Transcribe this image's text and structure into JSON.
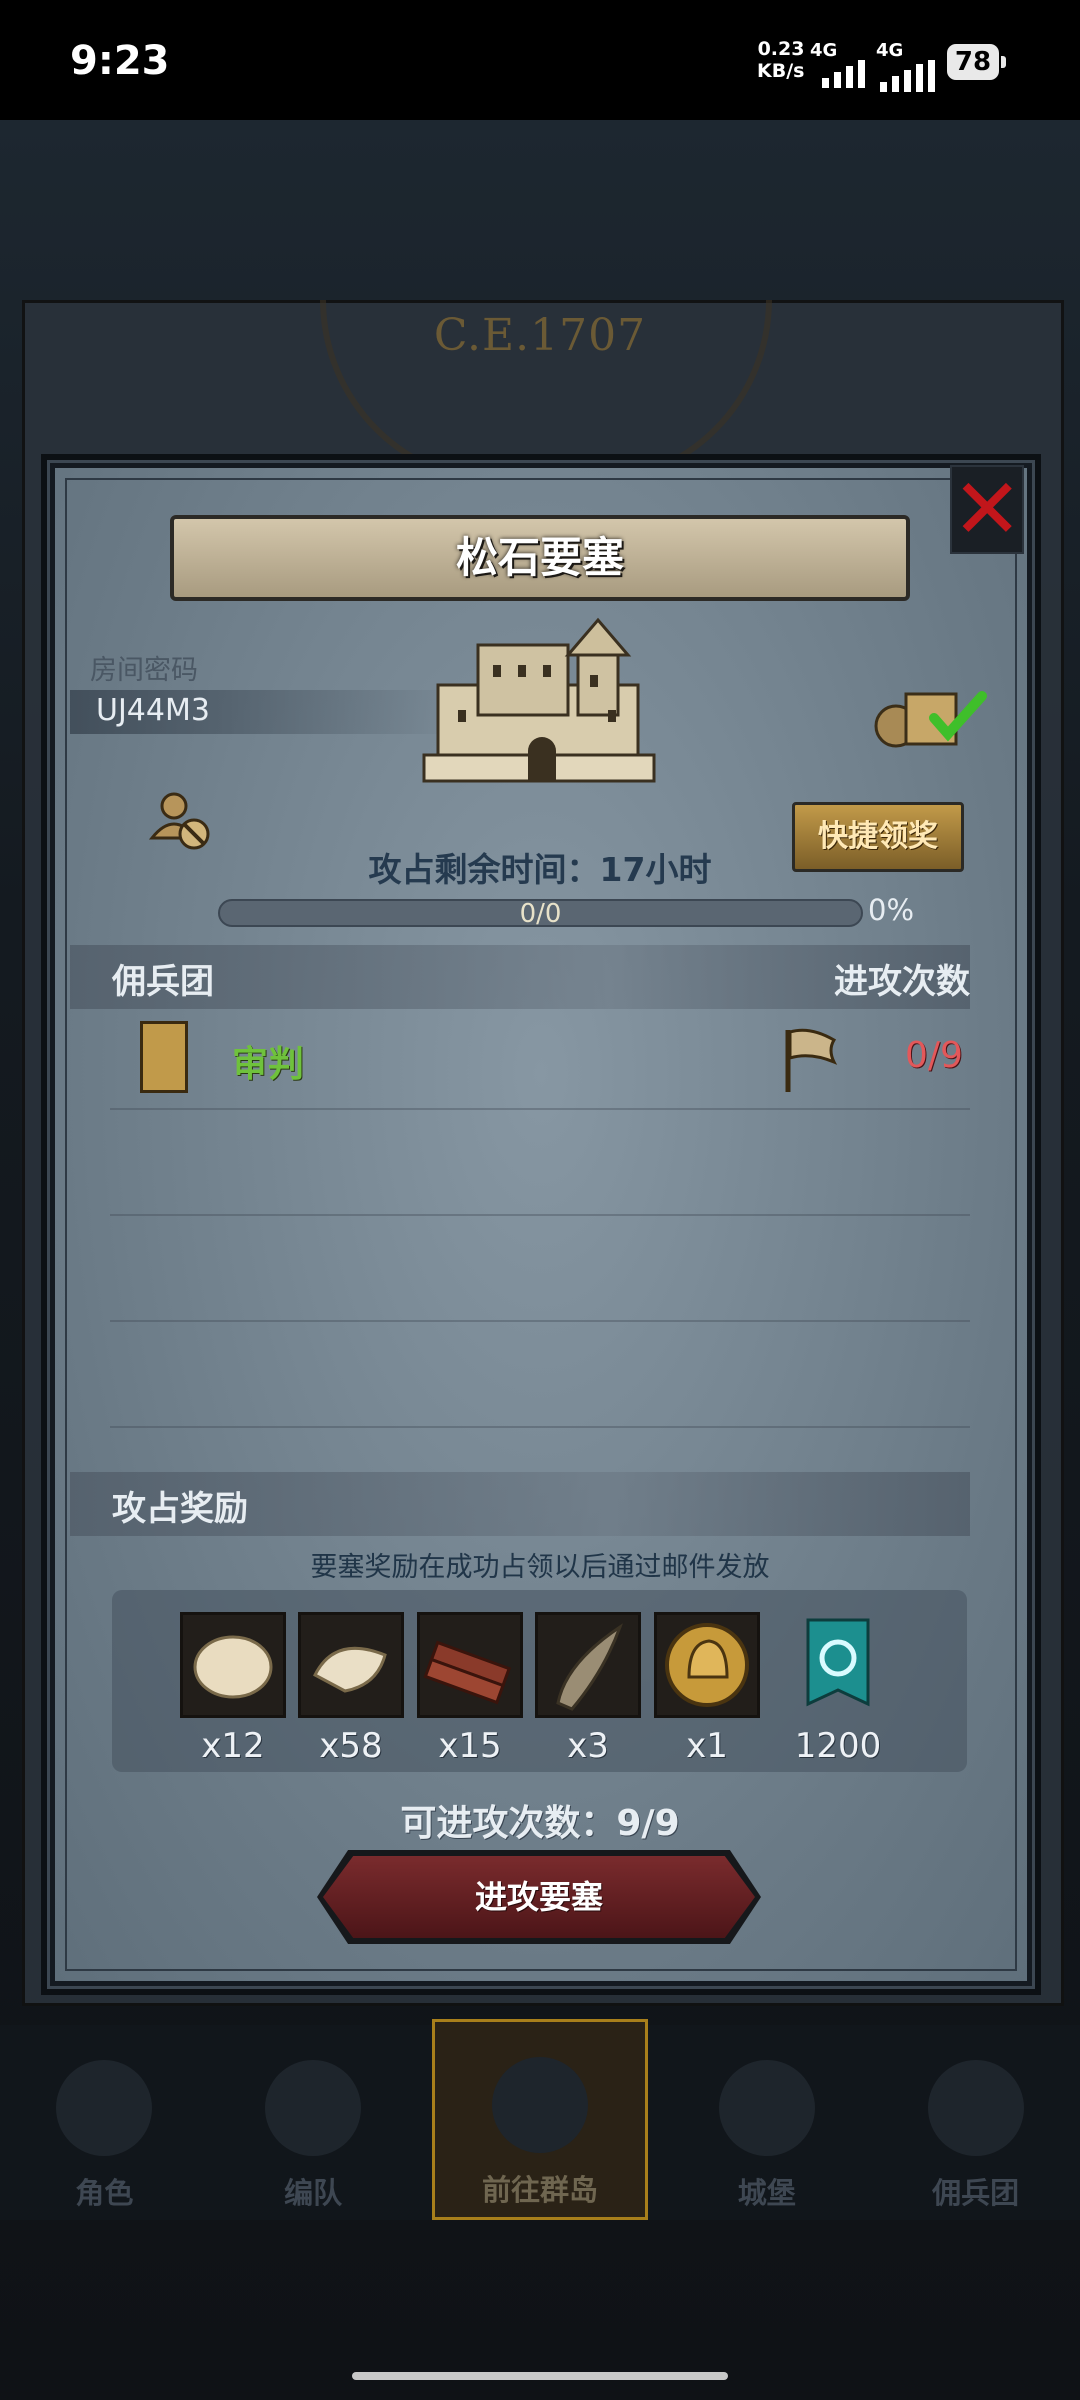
{
  "status_bar": {
    "time": "9:23",
    "net_speed_value": "0.23",
    "net_speed_unit": "KB/s",
    "sim1": "4G",
    "sim2": "4G",
    "battery": "78"
  },
  "background": {
    "era_label": "C.E.1707"
  },
  "dialog": {
    "title": "松石要塞",
    "room_label": "房间密码",
    "room_code": "UJ44M3",
    "quick_claim": "快捷领奖",
    "time_left": "攻占剩余时间：17小时",
    "progress_text": "0/0",
    "progress_fraction": 0,
    "progress_percent": "0%",
    "guild_header": "佣兵团",
    "attacks_header": "进攻次数",
    "guild_name": "审判",
    "guild_attacks": "0/9",
    "rewards_header": "攻占奖励",
    "rewards_note": "要塞奖励在成功占领以后通过邮件发放",
    "rewards": [
      {
        "icon": "fur-pelt-icon",
        "qty": "x12"
      },
      {
        "icon": "wool-fleece-icon",
        "qty": "x58"
      },
      {
        "icon": "lumber-planks-icon",
        "qty": "x15"
      },
      {
        "icon": "horn-icon",
        "qty": "x3"
      },
      {
        "icon": "knight-helmet-coin-icon",
        "qty": "x1"
      },
      {
        "icon": "guild-banner-icon",
        "qty": "1200"
      }
    ],
    "attacks_available": "可进攻次数：9/9",
    "attack_button": "进攻要塞"
  },
  "bottom_nav": {
    "items": [
      {
        "label": "角色",
        "icon": "character-icon"
      },
      {
        "label": "编队",
        "icon": "formation-icon"
      },
      {
        "label": "前往群岛",
        "icon": "islands-map-icon"
      },
      {
        "label": "城堡",
        "icon": "castle-icon"
      },
      {
        "label": "佣兵团",
        "icon": "mercenary-guild-icon"
      }
    ]
  },
  "colors": {
    "guild_name": "#6fc23c",
    "attack_count": "#e3585a",
    "close_x": "#c2161b",
    "quick_button": "#c29a49",
    "attack_button": "#7a2b2d"
  }
}
